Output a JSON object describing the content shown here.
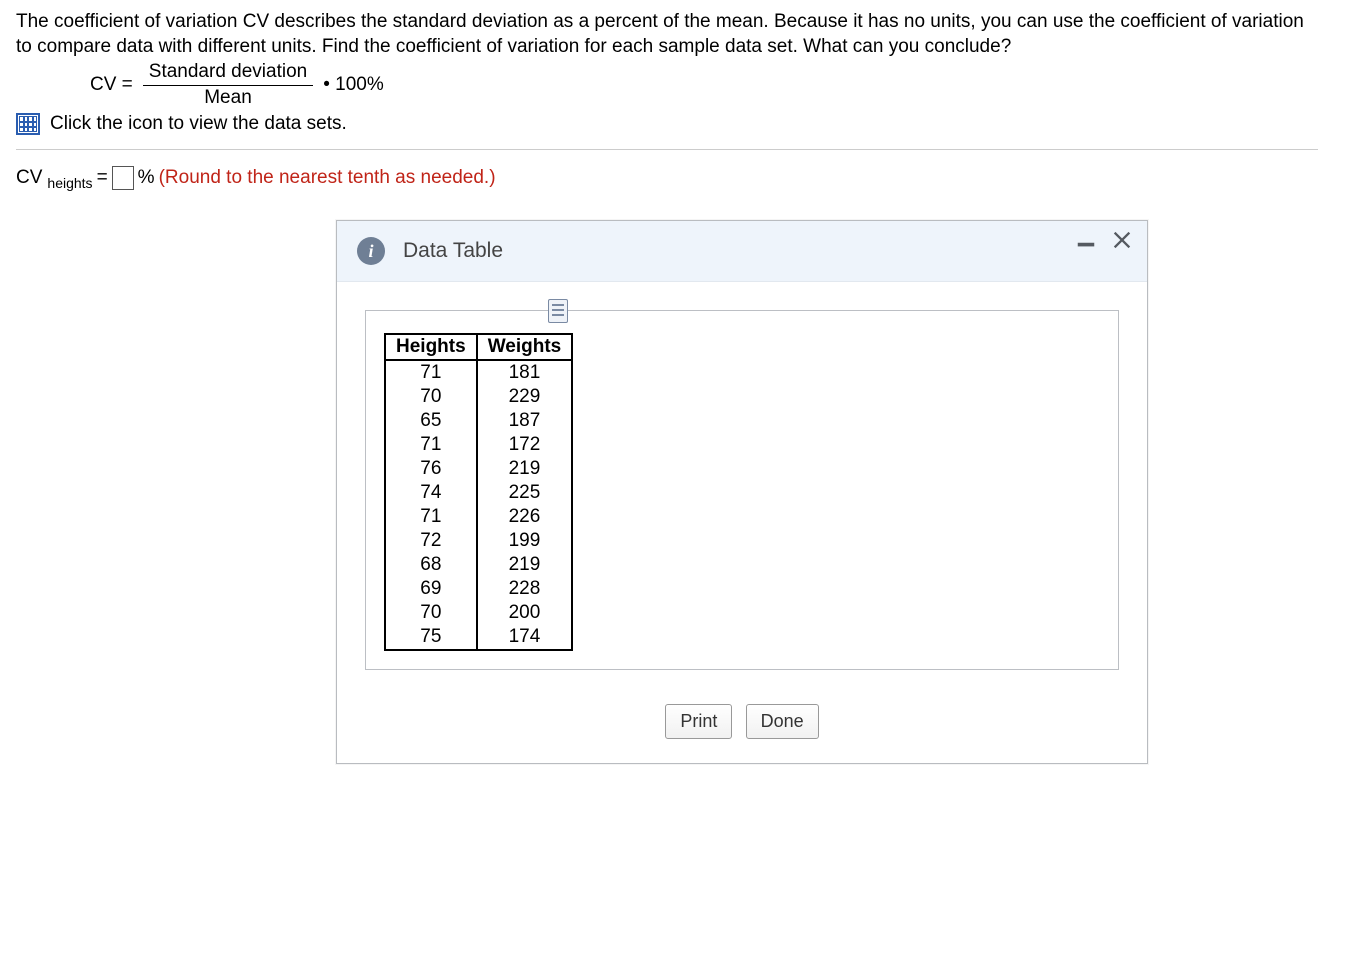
{
  "problem": {
    "text": "The coefficient of variation CV describes the standard deviation as a percent of the mean. Because it has no units, you can use the coefficient of variation to compare data with different units. Find the coefficient of variation for each sample data set. What can you conclude?",
    "cv_label": "CV =",
    "numerator": "Standard deviation",
    "denominator": "Mean",
    "tail": "• 100%",
    "link_text": "Click the icon to view the data sets."
  },
  "answer": {
    "prefix": "CV",
    "subscript": "heights",
    "equals": " = ",
    "percent": "%",
    "hint": " (Round to the nearest tenth as needed.)"
  },
  "dialog": {
    "title": "Data Table",
    "buttons": {
      "print": "Print",
      "done": "Done"
    }
  },
  "table": {
    "headers": {
      "h1": "Heights",
      "h2": "Weights"
    },
    "rows": [
      {
        "h": "71",
        "w": "181"
      },
      {
        "h": "70",
        "w": "229"
      },
      {
        "h": "65",
        "w": "187"
      },
      {
        "h": "71",
        "w": "172"
      },
      {
        "h": "76",
        "w": "219"
      },
      {
        "h": "74",
        "w": "225"
      },
      {
        "h": "71",
        "w": "226"
      },
      {
        "h": "72",
        "w": "199"
      },
      {
        "h": "68",
        "w": "219"
      },
      {
        "h": "69",
        "w": "228"
      },
      {
        "h": "70",
        "w": "200"
      },
      {
        "h": "75",
        "w": "174"
      }
    ]
  }
}
